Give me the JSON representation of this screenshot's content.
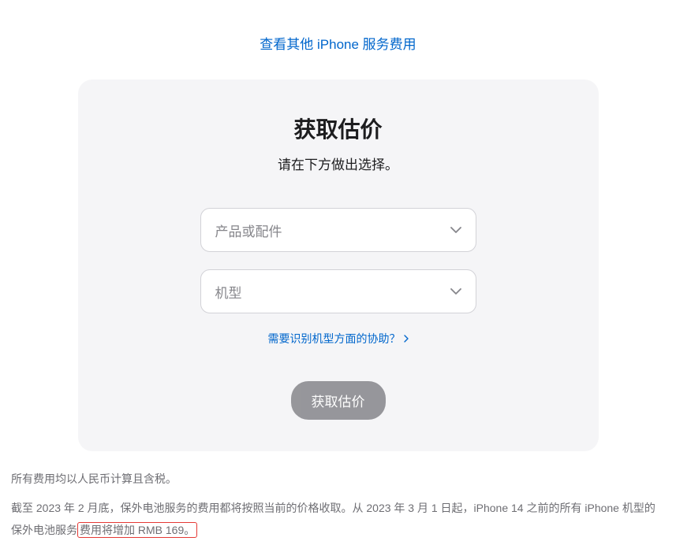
{
  "topLink": {
    "label": "查看其他 iPhone 服务费用"
  },
  "card": {
    "title": "获取估价",
    "subtitle": "请在下方做出选择。",
    "select1": {
      "placeholder": "产品或配件"
    },
    "select2": {
      "placeholder": "机型"
    },
    "helpLink": {
      "label": "需要识别机型方面的协助？"
    },
    "submitButton": {
      "label": "获取估价"
    }
  },
  "footer": {
    "line1": "所有费用均以人民币计算且含税。",
    "line2a": "截至 2023 年 2 月底，保外电池服务的费用都将按照当前的价格收取。从 2023 年 3 月 1 日起，iPhone 14 之前的所有 iPhone 机型的保外电池服务",
    "line2b": "费用将增加 RMB 169。"
  }
}
